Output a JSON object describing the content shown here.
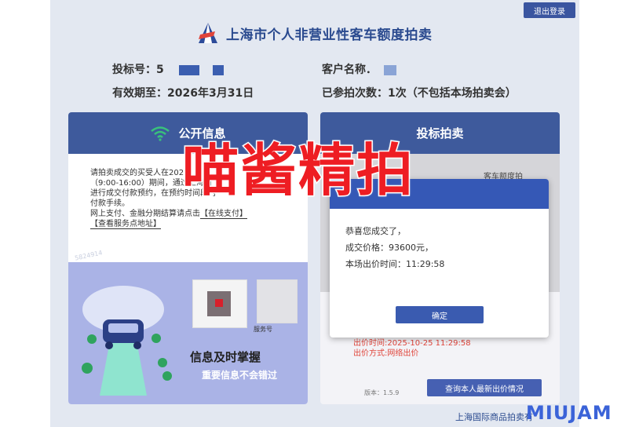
{
  "header": {
    "title": "上海市个人非营业性客车额度拍卖",
    "logout_label": "退出登录"
  },
  "info": {
    "bid_no_label": "投标号：5",
    "customer_name_label": "客户名称．",
    "expiry_label": "有效期至：2026年3月31日",
    "participations_label": "已参拍次数：1次（不包括本场拍卖会）"
  },
  "left_panel": {
    "title": "公开信息",
    "text_lines": [
      "请拍卖成交的买受人在2025",
      "（9:00-16:00）期间，通过上海国",
      "进行成交付款预约，在预约时间段内",
      "付款手续。",
      "网上支付、金融分期结算请点击"
    ],
    "link_online_pay": "【在线支付】",
    "link_service_address": "【查看服务点地址】",
    "faint_code": "5824914",
    "qr_caption": "服务号",
    "slogan_main": "信息及时掌握",
    "slogan_sub": "重要信息不会错过"
  },
  "right_panel": {
    "title": "投标拍卖",
    "bg_text": "客车额度拍",
    "bid_time": "出价时间:2025-10-25 11:29:58",
    "bid_method": "出价方式:网络出价",
    "version": "版本：1.5.9",
    "query_button": "查询本人最新出价情况"
  },
  "dialog": {
    "line1": "恭喜您成交了，",
    "line2": "成交价格：93600元，",
    "line3": "本场出价时间：11:29:58",
    "ok_label": "确定"
  },
  "watermark": "喵酱精拍",
  "footer": {
    "org": "上海国际商品拍卖有",
    "brand": "MIUJAM"
  },
  "colors": {
    "primary": "#3e5a9c",
    "dialog_header": "#3558b6",
    "watermark": "#ee1d23",
    "alert_text": "#e0443a"
  }
}
